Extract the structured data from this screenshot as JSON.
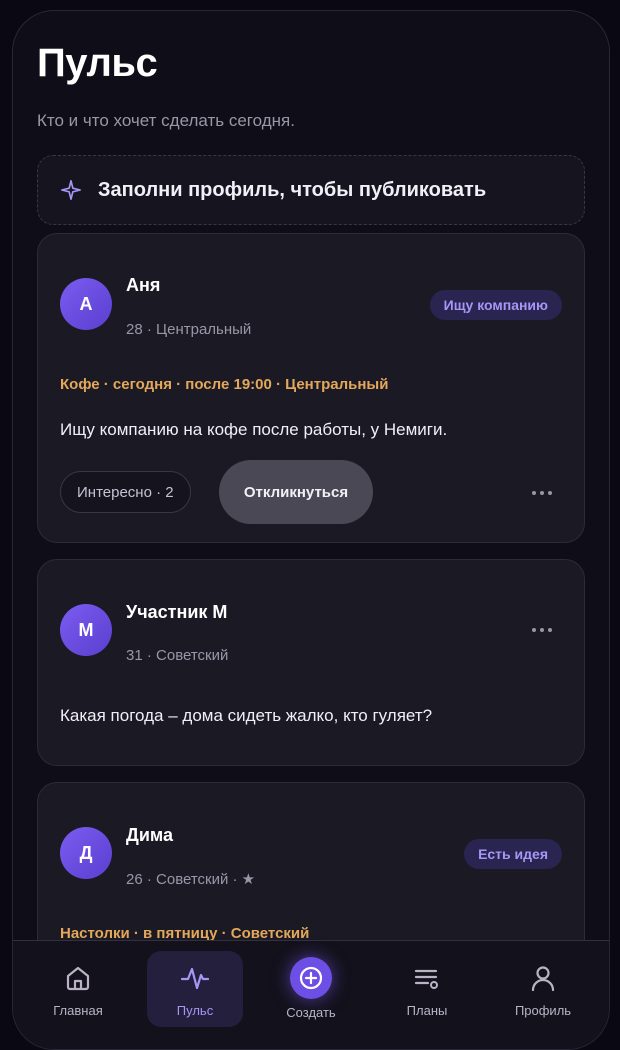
{
  "header": {
    "title": "Пульс",
    "subtitle": "Кто и что хочет сделать сегодня."
  },
  "profile_cta": {
    "icon": "sparkle-icon",
    "text": "Заполни профиль, чтобы публиковать"
  },
  "posts": [
    {
      "initial": "А",
      "name": "Аня",
      "meta": "28 · Центральный",
      "tag": "Ищу компанию",
      "event": "Кофе · сегодня · после 19:00 · Центральный",
      "text": "Ищу компанию на кофе после работы, у Немиги.",
      "interest_label": "Интересно · 2",
      "respond_label": "Откликнуться"
    },
    {
      "initial": "М",
      "name": "Участник М",
      "meta": "31 · Советский",
      "text": "Какая погода – дома сидеть жалко, кто гуляет?"
    },
    {
      "initial": "Д",
      "name": "Дима",
      "meta": "26 · Советский · ★",
      "tag": "Есть идея",
      "event": "Настолки · в пятницу · Советский"
    }
  ],
  "tabbar": {
    "active": "Пульс",
    "items": [
      {
        "label": "Главная",
        "icon": "home-icon"
      },
      {
        "label": "Пульс",
        "icon": "pulse-icon"
      },
      {
        "label": "Создать",
        "icon": "plus-circle-icon"
      },
      {
        "label": "Планы",
        "icon": "list-icon"
      },
      {
        "label": "Профиль",
        "icon": "user-icon"
      }
    ]
  },
  "colors": {
    "accent": "#7c5cf6",
    "event": "#e3a85a",
    "tag_bg": "#2a2450"
  }
}
